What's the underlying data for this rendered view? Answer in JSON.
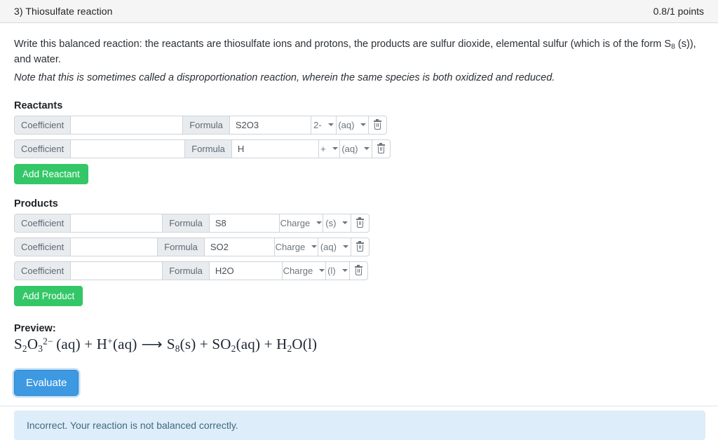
{
  "header": {
    "title": "3) Thiosulfate reaction",
    "points": "0.8/1 points"
  },
  "prompt": {
    "line1_a": "Write this balanced reaction: the reactants are thiosulfate ions and protons, the products are sulfur dioxide, elemental sulfur (which is of the form S",
    "line1_sub": "8",
    "line1_b": " (s)), and water.",
    "note": "Note that this is sometimes called a disproportionation reaction, wherein the same species is both oxidized and reduced."
  },
  "reactants": {
    "section_label": "Reactants",
    "add_button": "Add Reactant",
    "rows": [
      {
        "coefficient_label": "Coefficient",
        "coefficient_value": "",
        "formula_label": "Formula",
        "formula_value": "S2O3",
        "charge": "2-",
        "state": "(aq)",
        "delete_icon": "trash-icon"
      },
      {
        "coefficient_label": "Coefficient",
        "coefficient_value": "",
        "formula_label": "Formula",
        "formula_value": "H",
        "charge": "+",
        "state": "(aq)",
        "delete_icon": "trash-icon"
      }
    ]
  },
  "products": {
    "section_label": "Products",
    "add_button": "Add Product",
    "rows": [
      {
        "coefficient_label": "Coefficient",
        "coefficient_value": "",
        "formula_label": "Formula",
        "formula_value": "S8",
        "charge": "Charge",
        "state": "(s)",
        "delete_icon": "trash-icon"
      },
      {
        "coefficient_label": "Coefficient",
        "coefficient_value": "",
        "formula_label": "Formula",
        "formula_value": "SO2",
        "charge": "Charge",
        "state": "(aq)",
        "delete_icon": "trash-icon"
      },
      {
        "coefficient_label": "Coefficient",
        "coefficient_value": "",
        "formula_label": "Formula",
        "formula_value": "H2O",
        "charge": "Charge",
        "state": "(l)",
        "delete_icon": "trash-icon"
      }
    ]
  },
  "preview": {
    "label": "Preview:",
    "equation_plain": "S2O3^2- (aq) + H+ (aq) ⟶ S8(s) + SO2(aq) + H2O(l)",
    "terms": {
      "t1_el1": "S",
      "t1_sub1": "2",
      "t1_el2": "O",
      "t1_sub2": "3",
      "t1_sup": "2−",
      "t1_state": "(aq)",
      "plus1": "+",
      "t2_el": "H",
      "t2_sup": "+",
      "t2_state": "(aq)",
      "arrow": "⟶",
      "t3_el": "S",
      "t3_sub": "8",
      "t3_state": "(s)",
      "plus2": "+",
      "t4_el": "SO",
      "t4_sub": "2",
      "t4_state": "(aq)",
      "plus3": "+",
      "t5_el": "H",
      "t5_sub": "2",
      "t5_el2": "O",
      "t5_state": "(l)"
    }
  },
  "evaluate_button": "Evaluate",
  "feedback": "Incorrect. Your reaction is not balanced correctly.",
  "colors": {
    "green": "#34c767",
    "blue": "#3d9ae2",
    "alert_bg": "#ddedf9",
    "alert_text": "#41697f",
    "header_bg": "#f5f5f5"
  }
}
